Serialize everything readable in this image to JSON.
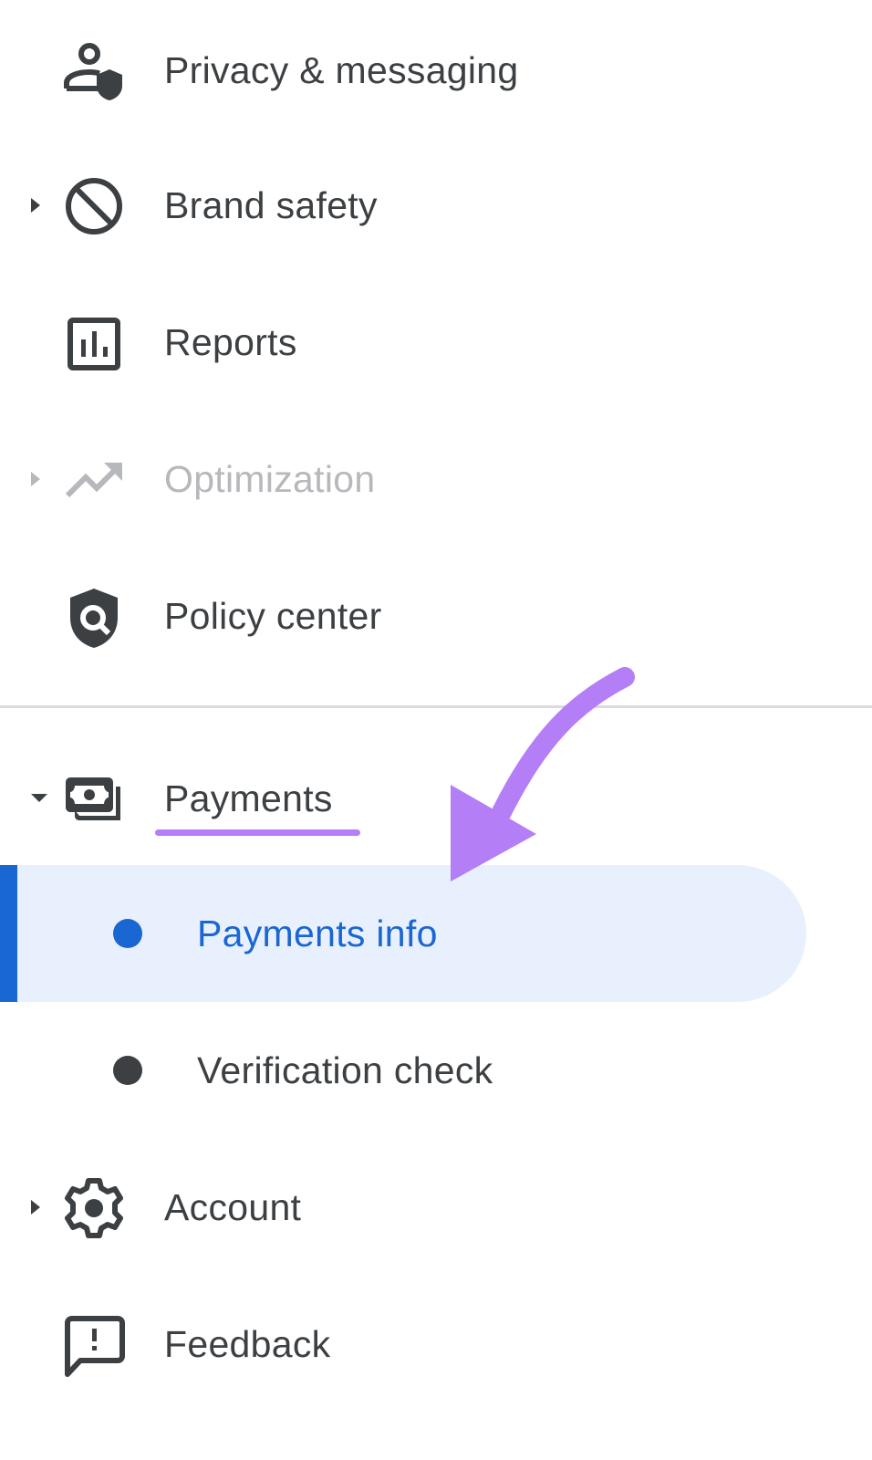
{
  "nav": {
    "items": [
      {
        "label": "Privacy & messaging",
        "icon": "privacy-shield-person-icon",
        "expandable": false,
        "disabled": false
      },
      {
        "label": "Brand safety",
        "icon": "block-icon",
        "expandable": true,
        "expanded": false,
        "disabled": false
      },
      {
        "label": "Reports",
        "icon": "bar-chart-icon",
        "expandable": false,
        "disabled": false
      },
      {
        "label": "Optimization",
        "icon": "trending-up-icon",
        "expandable": true,
        "expanded": false,
        "disabled": true
      },
      {
        "label": "Policy center",
        "icon": "policy-shield-search-icon",
        "expandable": false,
        "disabled": false
      },
      {
        "label": "Payments",
        "icon": "payments-money-icon",
        "expandable": true,
        "expanded": true,
        "disabled": false,
        "children": [
          {
            "label": "Payments info",
            "active": true
          },
          {
            "label": "Verification check",
            "active": false
          }
        ]
      },
      {
        "label": "Account",
        "icon": "gear-icon",
        "expandable": true,
        "expanded": false,
        "disabled": false
      },
      {
        "label": "Feedback",
        "icon": "feedback-icon",
        "expandable": false,
        "disabled": false
      }
    ]
  },
  "annotation": {
    "highlight_color": "#b47ef7",
    "target": "Payments info"
  },
  "colors": {
    "text": "#3c4043",
    "disabled_text": "#b6b8bb",
    "active_text": "#1a66d2",
    "active_bg": "#e8f0fe",
    "active_bar": "#1967d2",
    "divider": "#dadce0"
  }
}
